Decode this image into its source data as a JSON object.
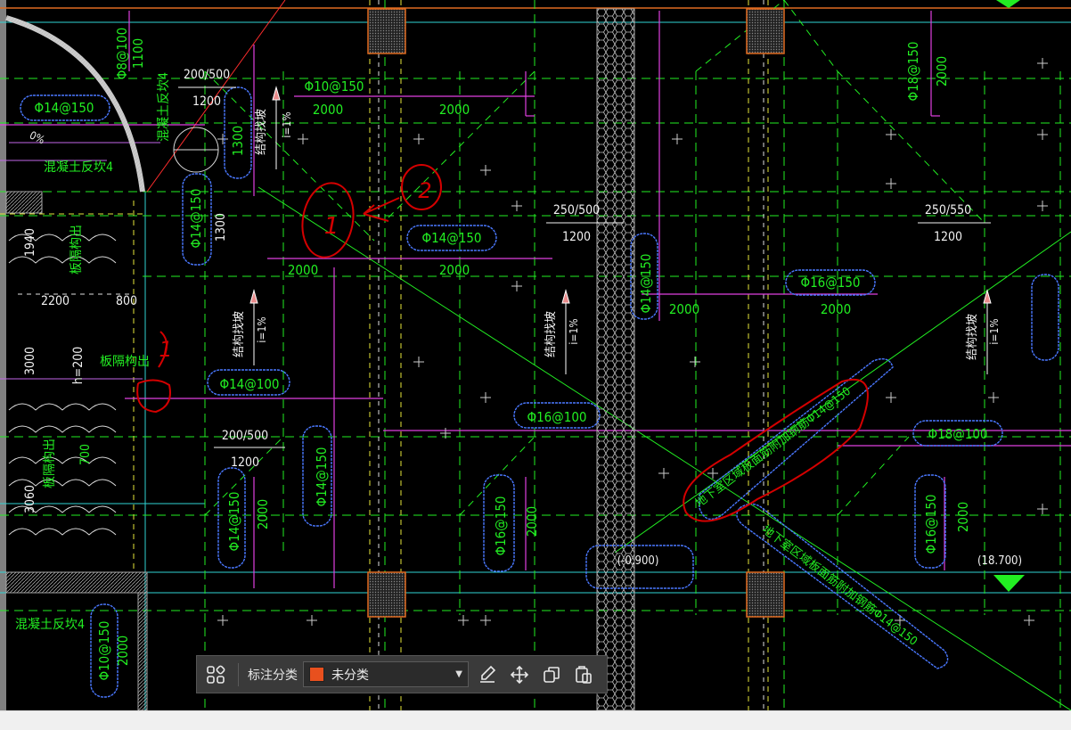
{
  "drawing": {
    "labels": [
      {
        "text": "Φ8@100"
      },
      {
        "text": "1100"
      },
      {
        "text": "200/500"
      },
      {
        "text": "1200"
      },
      {
        "text": "Φ14@150"
      },
      {
        "text": "Φ10@150"
      },
      {
        "text": "2000"
      },
      {
        "text": "2000"
      },
      {
        "text": "Φ14@150"
      },
      {
        "text": "2000"
      },
      {
        "text": "Φ18@150"
      },
      {
        "text": "2000"
      },
      {
        "text": "250/500"
      },
      {
        "text": "1200"
      },
      {
        "text": "250/550"
      },
      {
        "text": "1200"
      },
      {
        "text": "Φ14@150"
      },
      {
        "text": "2000"
      },
      {
        "text": "2000"
      },
      {
        "text": "Φ14@150"
      },
      {
        "text": "2000"
      },
      {
        "text": "Φ16@150"
      },
      {
        "text": "2000"
      },
      {
        "text": "Φ14@100"
      },
      {
        "text": "Φ16@100"
      },
      {
        "text": "Φ18@100"
      },
      {
        "text": "200/500"
      },
      {
        "text": "1200"
      },
      {
        "text": "2200"
      },
      {
        "text": "800"
      },
      {
        "text": "h=200"
      },
      {
        "text": "3000"
      },
      {
        "text": "1940"
      },
      {
        "text": "700"
      },
      {
        "text": "3060"
      },
      {
        "text": "(-0.900)"
      },
      {
        "text": "(18.700)"
      },
      {
        "text": "Φ14@150"
      },
      {
        "text": "2000"
      },
      {
        "text": "Φ14@150"
      },
      {
        "text": "Φ16@150"
      },
      {
        "text": "2000"
      },
      {
        "text": "Φ16@150"
      },
      {
        "text": "2000"
      },
      {
        "text": "Φ10@150"
      },
      {
        "text": "2000"
      },
      {
        "text": "混凝土反坎4"
      },
      {
        "text": "混凝土反坎4"
      },
      {
        "text": "混凝土反坎4"
      },
      {
        "text": "板隔构出"
      },
      {
        "text": "板隔构出"
      },
      {
        "text": "板隔构出"
      },
      {
        "text": "结构找坡"
      },
      {
        "text": "i=1%"
      },
      {
        "text": "结构找坡"
      },
      {
        "text": "i=1%"
      },
      {
        "text": "结构找坡"
      },
      {
        "text": "i=1%"
      },
      {
        "text": "结构找坡"
      },
      {
        "text": "i=1%"
      },
      {
        "text": "地下室区域板面筋附加钢筋Φ14@150"
      },
      {
        "text": "地下室区域板面筋附加钢筋Φ14@150"
      },
      {
        "text": "1300"
      },
      {
        "text": "1300"
      },
      {
        "text": "0%"
      }
    ],
    "markup": [
      {
        "text": "1"
      },
      {
        "text": "2"
      },
      {
        "text": "1"
      }
    ]
  },
  "toolbar": {
    "label": "标注分类",
    "category": "未分类",
    "category_color": "#e8501e",
    "buttons": [
      "grid-icon",
      "edit-icon",
      "move-icon",
      "copy-icon",
      "paste-icon"
    ]
  }
}
